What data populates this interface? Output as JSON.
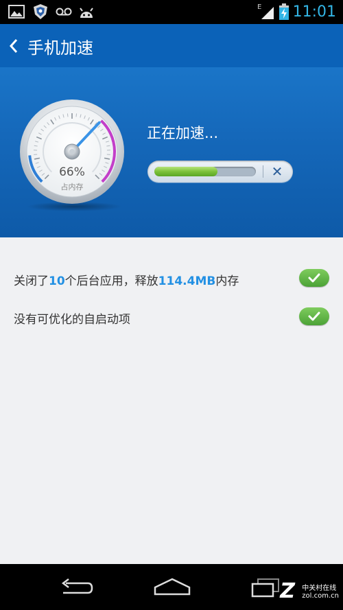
{
  "status_bar": {
    "time": "11:01",
    "network": "E",
    "icons": [
      "gallery-icon",
      "shield-icon",
      "voicemail-icon",
      "android-icon",
      "signal-icon",
      "battery-charging-icon"
    ]
  },
  "action_bar": {
    "title": "手机加速"
  },
  "gauge": {
    "percent_text": "66%",
    "percent_value": 0.66,
    "label": "占内存"
  },
  "accel": {
    "status": "正在加速...",
    "progress": 0.62,
    "cancel_symbol": "✕"
  },
  "results": [
    {
      "prefix": "关闭了",
      "count": "10",
      "middle": "个后台应用，释放",
      "amount": "114.4MB",
      "suffix": "内存",
      "done": true
    },
    {
      "text": "没有可优化的自启动项",
      "done": true
    }
  ],
  "watermark": {
    "line1": "中关村在线",
    "line2": "zol.com.cn"
  },
  "colors": {
    "accent": "#33b5e5",
    "header_blue": "#1568ba",
    "highlight": "#2290e3",
    "success": "#5bb140"
  }
}
